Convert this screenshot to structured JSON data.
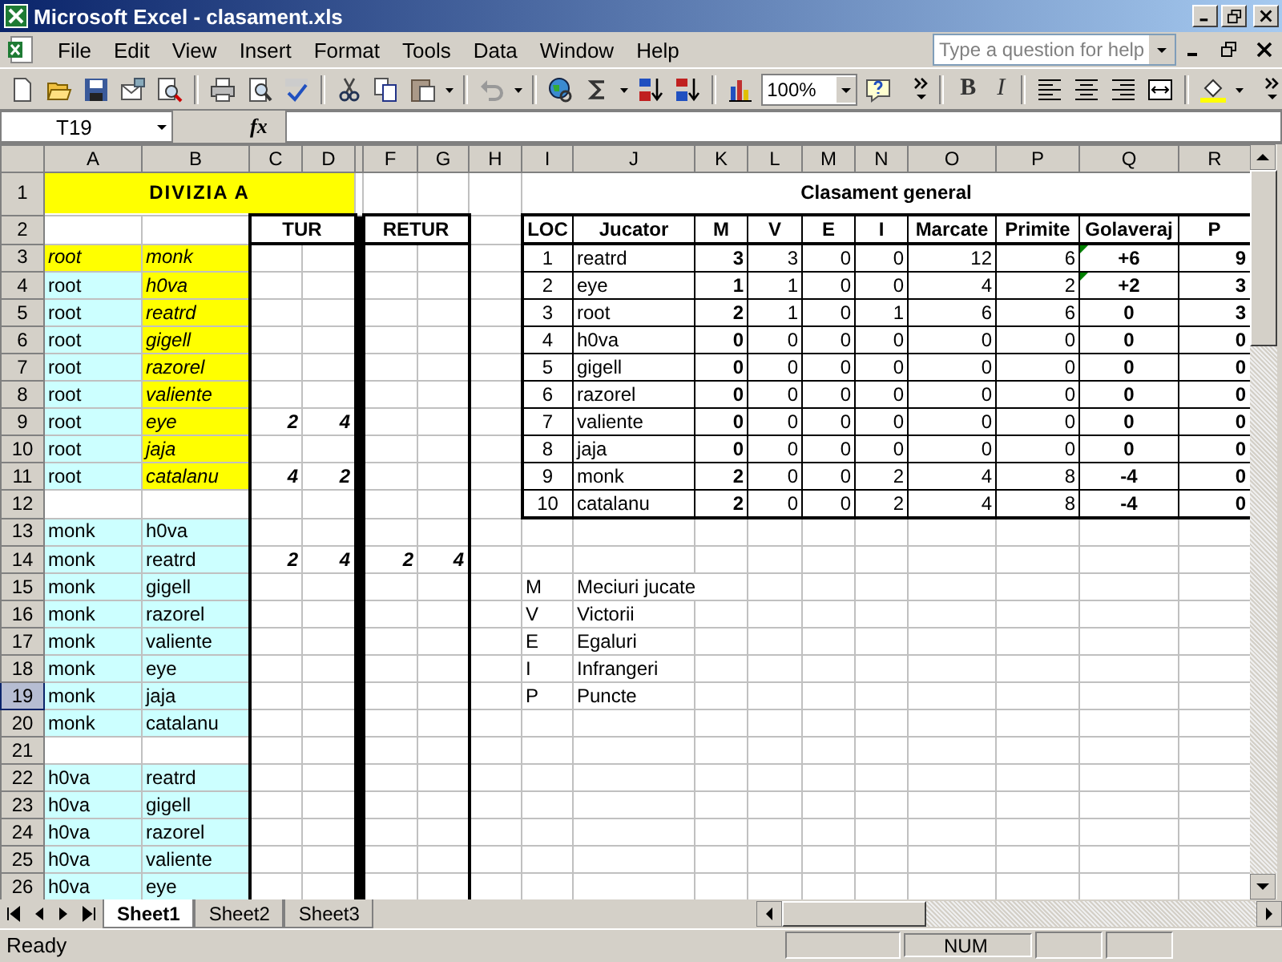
{
  "window": {
    "title": "Microsoft Excel - clasament.xls"
  },
  "menu": [
    "File",
    "Edit",
    "View",
    "Insert",
    "Format",
    "Tools",
    "Data",
    "Window",
    "Help"
  ],
  "help_box": {
    "placeholder": "Type a question for help"
  },
  "toolbar": {
    "zoom": "100%",
    "format_buttons": [
      "B",
      "I"
    ]
  },
  "formula_bar": {
    "name_box": "T19",
    "function_label": "fx"
  },
  "columns": [
    {
      "label": "A"
    },
    {
      "label": "B"
    },
    {
      "label": "C"
    },
    {
      "label": "D"
    },
    {},
    {
      "label": "F"
    },
    {
      "label": "G"
    },
    {
      "label": "H"
    },
    {
      "label": "I"
    },
    {
      "label": "J"
    },
    {
      "label": "K"
    },
    {
      "label": "L"
    },
    {
      "label": "M"
    },
    {
      "label": "N"
    },
    {
      "label": "O"
    },
    {
      "label": "P"
    },
    {
      "label": "Q"
    },
    {
      "label": "R"
    }
  ],
  "row_numbers": [
    {
      "label": "1",
      "selected": false
    },
    {
      "label": "2",
      "selected": false
    },
    {
      "label": "3",
      "selected": false
    },
    {
      "label": "4",
      "selected": false
    },
    {
      "label": "5",
      "selected": false
    },
    {
      "label": "6",
      "selected": false
    },
    {
      "label": "7",
      "selected": false
    },
    {
      "label": "8",
      "selected": false
    },
    {
      "label": "9",
      "selected": false
    },
    {
      "label": "10",
      "selected": false
    },
    {
      "label": "11",
      "selected": false
    },
    {
      "label": "12",
      "selected": false
    },
    {
      "label": "13",
      "selected": false
    },
    {
      "label": "14",
      "selected": false
    },
    {
      "label": "15",
      "selected": false
    },
    {
      "label": "16",
      "selected": false
    },
    {
      "label": "17",
      "selected": false
    },
    {
      "label": "18",
      "selected": false
    },
    {
      "label": "19",
      "selected": true
    },
    {
      "label": "20",
      "selected": false
    },
    {
      "label": "21",
      "selected": false
    },
    {
      "label": "22",
      "selected": false
    },
    {
      "label": "23",
      "selected": false
    },
    {
      "label": "24",
      "selected": false
    },
    {
      "label": "25",
      "selected": false
    },
    {
      "label": "26",
      "selected": false
    }
  ],
  "division": {
    "title": "DIVIZIA A",
    "first_leg": "TUR",
    "second_leg": "RETUR",
    "groups": [
      {
        "matches": [
          {
            "home": "root",
            "away": "monk",
            "home_highlighted": true,
            "away_highlighted": true
          },
          {
            "home": "root",
            "away": "h0va",
            "home_highlighted": false,
            "away_highlighted": true
          },
          {
            "home": "root",
            "away": "reatrd",
            "home_highlighted": false,
            "away_highlighted": true
          },
          {
            "home": "root",
            "away": "gigell",
            "home_highlighted": false,
            "away_highlighted": true
          },
          {
            "home": "root",
            "away": "razorel",
            "home_highlighted": false,
            "away_highlighted": true
          },
          {
            "home": "root",
            "away": "valiente",
            "home_highlighted": false,
            "away_highlighted": true
          },
          {
            "home": "root",
            "away": "eye",
            "home_highlighted": false,
            "away_highlighted": true,
            "first_leg": [
              "2",
              "4"
            ]
          },
          {
            "home": "root",
            "away": "jaja",
            "home_highlighted": false,
            "away_highlighted": true
          },
          {
            "home": "root",
            "away": "catalanu",
            "home_highlighted": false,
            "away_highlighted": true,
            "first_leg": [
              "4",
              "2"
            ]
          }
        ]
      },
      {
        "matches": [
          {
            "home": "monk",
            "away": "h0va",
            "home_highlighted": false,
            "away_highlighted": false
          },
          {
            "home": "monk",
            "away": "reatrd",
            "home_highlighted": false,
            "away_highlighted": false,
            "first_leg": [
              "2",
              "4"
            ],
            "second_leg": [
              "2",
              "4"
            ]
          },
          {
            "home": "monk",
            "away": "gigell",
            "home_highlighted": false,
            "away_highlighted": false
          },
          {
            "home": "monk",
            "away": "razorel",
            "home_highlighted": false,
            "away_highlighted": false
          },
          {
            "home": "monk",
            "away": "valiente",
            "home_highlighted": false,
            "away_highlighted": false
          },
          {
            "home": "monk",
            "away": "eye",
            "home_highlighted": false,
            "away_highlighted": false
          },
          {
            "home": "monk",
            "away": "jaja",
            "home_highlighted": false,
            "away_highlighted": false
          },
          {
            "home": "monk",
            "away": "catalanu",
            "home_highlighted": false,
            "away_highlighted": false
          }
        ]
      },
      {
        "matches": [
          {
            "home": "h0va",
            "away": "reatrd",
            "home_highlighted": false,
            "away_highlighted": false
          },
          {
            "home": "h0va",
            "away": "gigell",
            "home_highlighted": false,
            "away_highlighted": false
          },
          {
            "home": "h0va",
            "away": "razorel",
            "home_highlighted": false,
            "away_highlighted": false
          },
          {
            "home": "h0va",
            "away": "valiente",
            "home_highlighted": false,
            "away_highlighted": false
          },
          {
            "home": "h0va",
            "away": "eye",
            "home_highlighted": false,
            "away_highlighted": false
          }
        ]
      }
    ]
  },
  "standings": {
    "title": "Clasament general",
    "columns": [
      "LOC",
      "Jucator",
      "M",
      "V",
      "E",
      "I",
      "Marcate",
      "Primite",
      "Golaveraj",
      "P"
    ],
    "rows": [
      {
        "loc": "1",
        "player": "reatrd",
        "played": "3",
        "won": "3",
        "drawn": "0",
        "lost": "0",
        "scored": "12",
        "conceded": "6",
        "goal_diff": "+6",
        "points": "9",
        "warning": true
      },
      {
        "loc": "2",
        "player": "eye",
        "played": "1",
        "won": "1",
        "drawn": "0",
        "lost": "0",
        "scored": "4",
        "conceded": "2",
        "goal_diff": "+2",
        "points": "3",
        "warning": true
      },
      {
        "loc": "3",
        "player": "root",
        "played": "2",
        "won": "1",
        "drawn": "0",
        "lost": "1",
        "scored": "6",
        "conceded": "6",
        "goal_diff": "0",
        "points": "3",
        "warning": false
      },
      {
        "loc": "4",
        "player": "h0va",
        "played": "0",
        "won": "0",
        "drawn": "0",
        "lost": "0",
        "scored": "0",
        "conceded": "0",
        "goal_diff": "0",
        "points": "0",
        "warning": false
      },
      {
        "loc": "5",
        "player": "gigell",
        "played": "0",
        "won": "0",
        "drawn": "0",
        "lost": "0",
        "scored": "0",
        "conceded": "0",
        "goal_diff": "0",
        "points": "0",
        "warning": false
      },
      {
        "loc": "6",
        "player": "razorel",
        "played": "0",
        "won": "0",
        "drawn": "0",
        "lost": "0",
        "scored": "0",
        "conceded": "0",
        "goal_diff": "0",
        "points": "0",
        "warning": false
      },
      {
        "loc": "7",
        "player": "valiente",
        "played": "0",
        "won": "0",
        "drawn": "0",
        "lost": "0",
        "scored": "0",
        "conceded": "0",
        "goal_diff": "0",
        "points": "0",
        "warning": false
      },
      {
        "loc": "8",
        "player": "jaja",
        "played": "0",
        "won": "0",
        "drawn": "0",
        "lost": "0",
        "scored": "0",
        "conceded": "0",
        "goal_diff": "0",
        "points": "0",
        "warning": false
      },
      {
        "loc": "9",
        "player": "monk",
        "played": "2",
        "won": "0",
        "drawn": "0",
        "lost": "2",
        "scored": "4",
        "conceded": "8",
        "goal_diff": "-4",
        "points": "0",
        "warning": false
      },
      {
        "loc": "10",
        "player": "catalanu",
        "played": "2",
        "won": "0",
        "drawn": "0",
        "lost": "2",
        "scored": "4",
        "conceded": "8",
        "goal_diff": "-4",
        "points": "0",
        "warning": false
      }
    ]
  },
  "legend": [
    {
      "key": "M",
      "meaning": "Meciuri jucate"
    },
    {
      "key": "V",
      "meaning": "Victorii"
    },
    {
      "key": "E",
      "meaning": "Egaluri"
    },
    {
      "key": "I",
      "meaning": "Infrangeri"
    },
    {
      "key": "P",
      "meaning": "Puncte"
    }
  ],
  "sheet_tabs": [
    {
      "label": "Sheet1",
      "selected": true
    },
    {
      "label": "Sheet2",
      "selected": false
    },
    {
      "label": "Sheet3",
      "selected": false
    }
  ],
  "status_bar": {
    "mode": "Ready",
    "indicators": [
      "NUM"
    ]
  }
}
